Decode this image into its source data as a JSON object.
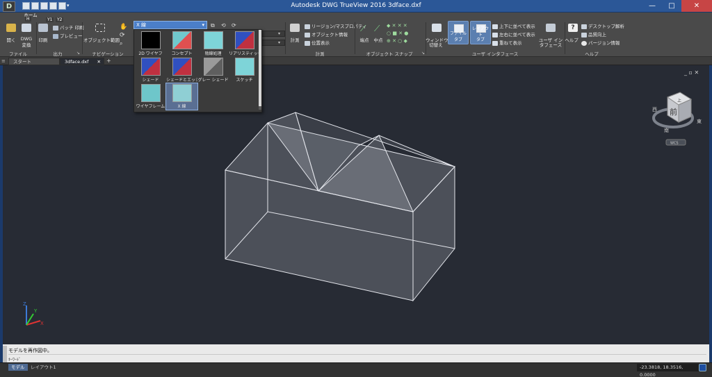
{
  "window": {
    "app_logo": "D",
    "title": "Autodesk DWG TrueView 2016        3dface.dxf",
    "minimize": "—",
    "maximize": "□",
    "close": "✕"
  },
  "qat": {
    "badge_1": "H",
    "badge_2": "Y1",
    "badge_3": "Y2"
  },
  "ribbon": {
    "tab": "ホーム",
    "file": {
      "open": "開く",
      "dwg_convert_1": "DWG",
      "dwg_convert_2": "変換",
      "panel": "ファイル"
    },
    "output": {
      "print": "印刷",
      "batch_print": "バッチ 印刷",
      "preview": "プレビュー",
      "panel": "出力"
    },
    "navigation": {
      "zoom_extents": "オブジェクト範囲",
      "panel": "ナビゲーション"
    },
    "visual_style": {
      "selected": "X 線",
      "options": [
        {
          "label": "2D ワイヤフ",
          "icon": "2d-wireframe-icon"
        },
        {
          "label": "コンセプト",
          "icon": "conceptual-icon"
        },
        {
          "label": "陰線処理",
          "icon": "hidden-icon"
        },
        {
          "label": "リアリスティック",
          "icon": "realistic-icon"
        },
        {
          "label": "シェード",
          "icon": "shaded-icon"
        },
        {
          "label": "シェードとエッジ",
          "icon": "shaded-edges-icon"
        },
        {
          "label": "グレー シェード",
          "icon": "gray-shade-icon"
        },
        {
          "label": "スケッチ",
          "icon": "sketch-icon"
        },
        {
          "label": "ワイヤフレーム",
          "icon": "wireframe-icon"
        },
        {
          "label": "X 線",
          "icon": "xray-icon"
        }
      ]
    },
    "measure": {
      "measure": "計測",
      "region_mass": "リージョン/マスプロパティ",
      "object_info": "オブジェクト情報",
      "locate": "位置表示",
      "panel": "計測"
    },
    "osnap": {
      "endpoint": "端点",
      "midpoint": "中点",
      "panel": "オブジェクト スナップ"
    },
    "ui": {
      "switch_window_1": "ウィンドウ",
      "switch_window_2": "切替え",
      "file_tabs": "ファイル タブ",
      "layout_tabs_1": "レイアウト",
      "layout_tabs_2": "タブ",
      "tile_vertical": "上下に並べて表示",
      "tile_horizontal": "左右に並べて表示",
      "cascade": "重ねて表示",
      "user_interface_1": "ユーザ イン",
      "user_interface_2": "タフェース",
      "panel": "ユーザ インタフェース"
    },
    "help": {
      "help": "ヘルプ",
      "desktop_analytics": "デスクトップ解析",
      "improvement": "品質向上",
      "version_info": "バージョン情報",
      "panel": "ヘルプ"
    }
  },
  "file_tabs": [
    {
      "label": "スタート",
      "active": false
    },
    {
      "label": "3dface.dxf",
      "active": true
    }
  ],
  "file_tab_add": "+",
  "viewport": {
    "controls": "_ ▫ ✕",
    "viewcube": {
      "face": "前",
      "top": "上",
      "east": "東",
      "south": "南",
      "west": "西",
      "wcs": "WCS"
    },
    "ucs": {
      "x": "X",
      "y": "Y",
      "z": "Z"
    }
  },
  "command": {
    "history": "モデルを再作図中。",
    "prompt_icon": "✕",
    "input_placeholder": "ｷｰﾜｰﾄﾞ"
  },
  "status": {
    "tabs": [
      {
        "label": "モデル",
        "active": true
      },
      {
        "label": "レイアウト1",
        "active": false
      }
    ],
    "coords": "-23.3818, 18.3516, 0.0000"
  }
}
